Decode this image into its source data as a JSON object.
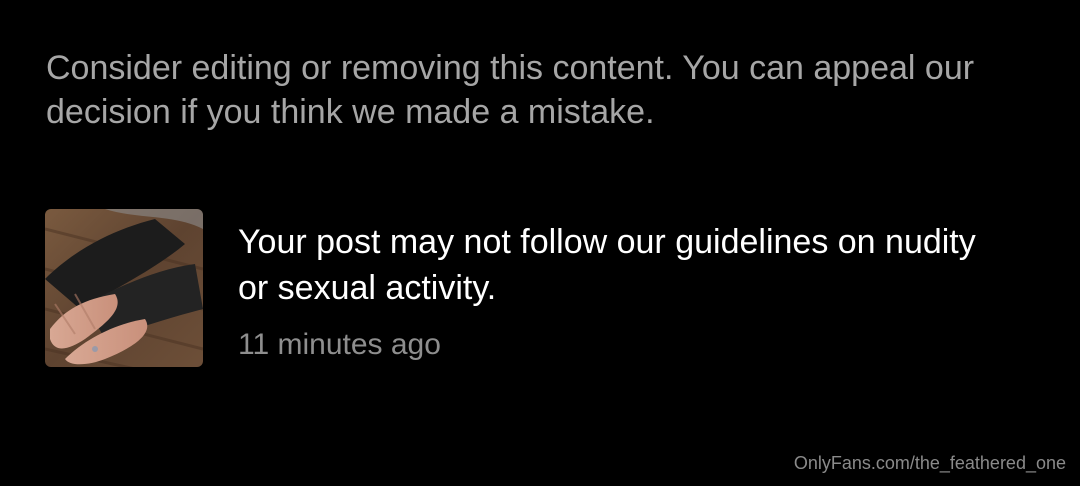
{
  "notice": {
    "text": "Consider editing or removing this content. You can appeal our decision if you think we made a mistake."
  },
  "notification": {
    "thumbnail_icon": "post-thumbnail-image",
    "title": "Your post may not follow our guidelines on nudity or sexual activity.",
    "time": "11 minutes ago"
  },
  "watermark": {
    "text": "OnlyFans.com/the_feathered_one"
  },
  "colors": {
    "background": "#000000",
    "primary_text": "#ffffff",
    "secondary_text": "#a6a6a6"
  }
}
